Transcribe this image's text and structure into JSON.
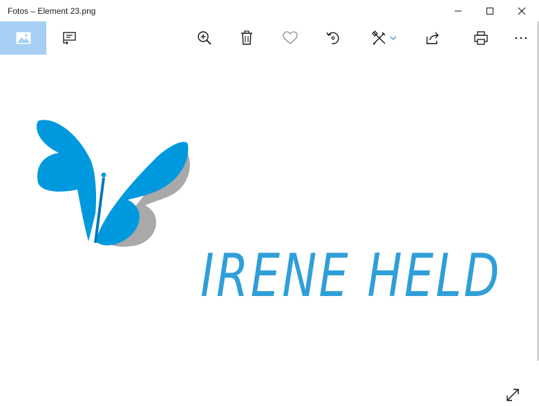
{
  "window": {
    "title": "Fotos – Element 23.png"
  },
  "toolbar": {
    "buttons": [
      {
        "name": "view-image-icon"
      },
      {
        "name": "slideshow-icon"
      },
      {
        "name": "zoom-in-icon"
      },
      {
        "name": "delete-icon"
      },
      {
        "name": "favorite-heart-icon"
      },
      {
        "name": "rotate-icon"
      },
      {
        "name": "edit-draw-icon"
      },
      {
        "name": "share-icon"
      },
      {
        "name": "print-icon"
      },
      {
        "name": "more-options-icon"
      }
    ]
  },
  "image": {
    "logo_text": "IRENE HELD",
    "butterfly_color": "#0099dd",
    "text_color": "#2f9fd8"
  },
  "colors": {
    "active_tab": "#a6cff3"
  }
}
